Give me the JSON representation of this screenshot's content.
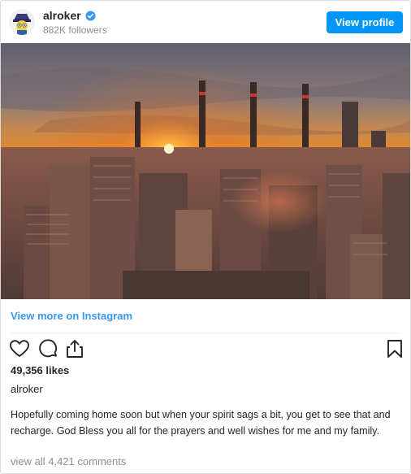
{
  "post": {
    "username": "alroker",
    "followers": "882K followers",
    "view_profile_label": "View profile",
    "view_more_label": "View more on Instagram",
    "likes": "49,356 likes",
    "caption_username": "alroker",
    "caption_text": "Hopefully coming home soon but when your spirit sags a bit, you get to see that and recharge. God Bless you all for the prayers and well wishes for me and my family.",
    "comments_link": "view all 4,421 comments"
  },
  "icons": {
    "verified": "verified-badge-icon",
    "like": "heart-icon",
    "comment": "comment-bubble-icon",
    "share": "share-icon",
    "save": "bookmark-icon"
  },
  "colors": {
    "primary_button": "#0095f6",
    "link": "#3897f0",
    "muted_text": "#8e8e8e"
  }
}
